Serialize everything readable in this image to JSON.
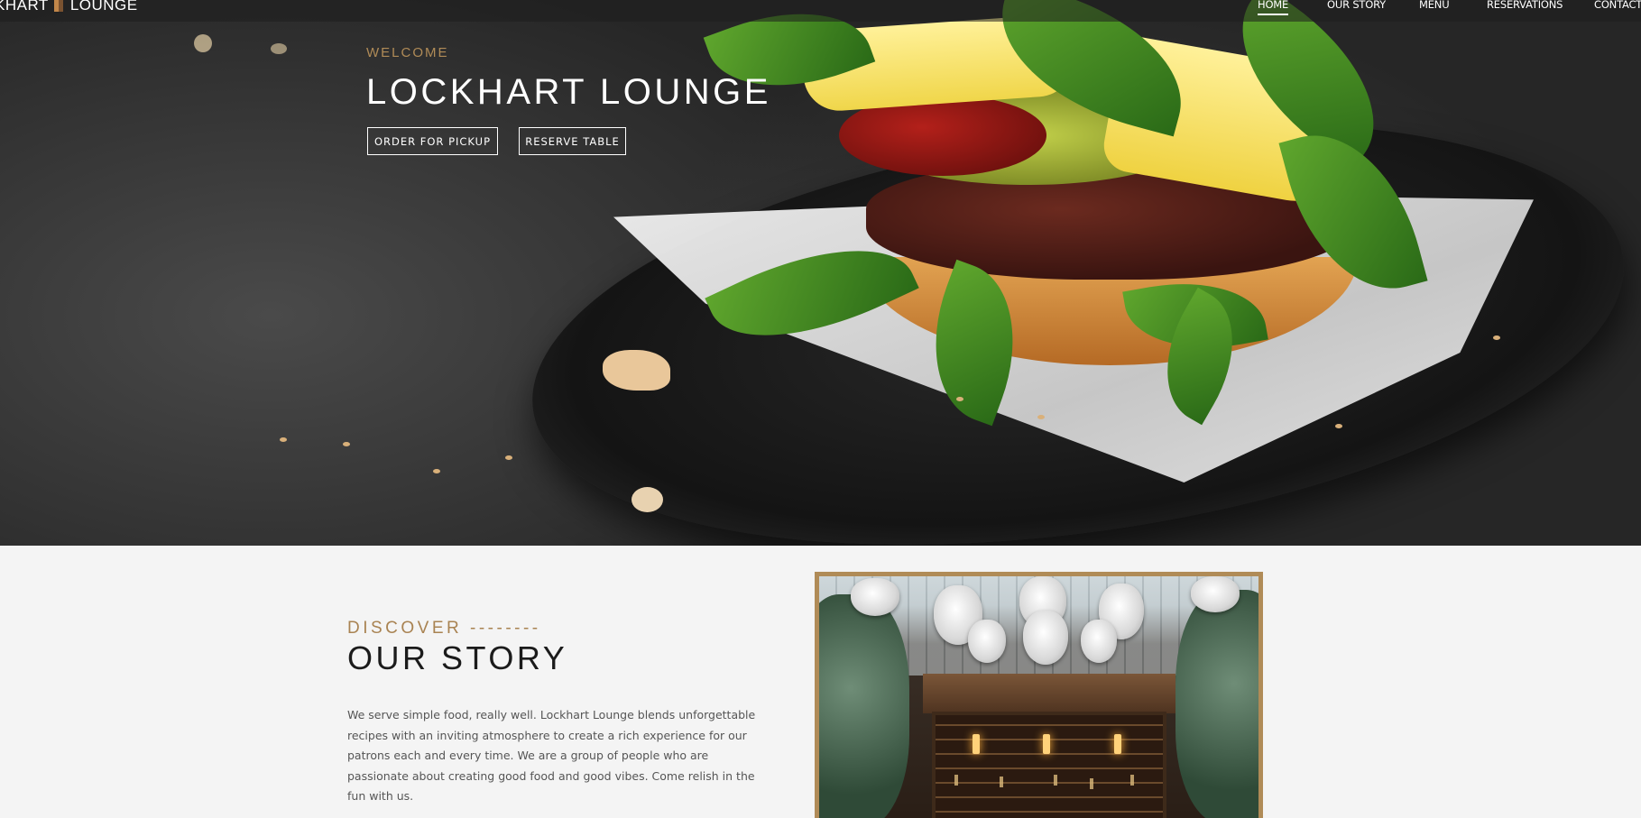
{
  "brand": {
    "logo_left": "KHART",
    "logo_right": "LOUNGE"
  },
  "nav": {
    "items": [
      {
        "label": "HOME",
        "active": true
      },
      {
        "label": "OUR STORY",
        "active": false
      },
      {
        "label": "MENU",
        "active": false
      },
      {
        "label": "RESERVATIONS",
        "active": false
      },
      {
        "label": "CONTACT",
        "active": false
      }
    ]
  },
  "hero": {
    "eyebrow": "WELCOME",
    "title": "LOCKHART LOUNGE",
    "buttons": {
      "pickup": "ORDER FOR PICKUP",
      "reserve": "RESERVE TABLE"
    }
  },
  "story": {
    "eyebrow": "DISCOVER --------",
    "title": "OUR STORY",
    "text": "We serve simple food, really well. Lockhart Lounge blends unforgettable recipes with an inviting atmosphere to create a rich experience for our patrons each and every time. We are a group of people who are passionate about creating good food and good vibes. Come relish in the fun with us."
  },
  "colors": {
    "accent": "#b08b57",
    "dark": "#1b1b1b",
    "background": "#f4f4f4"
  }
}
